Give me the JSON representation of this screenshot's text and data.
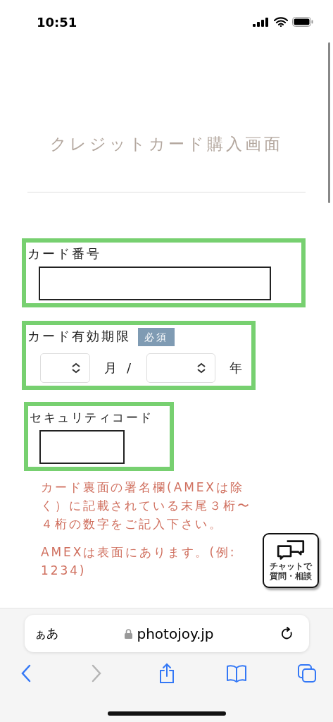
{
  "status_bar": {
    "time": "10:51"
  },
  "title": "クレジットカード購入画面",
  "card_number": {
    "label": "カード番号"
  },
  "expiry": {
    "label": "カード有効期限",
    "required_badge": "必須",
    "month_unit": "月",
    "separator": "/",
    "year_unit": "年"
  },
  "security_code": {
    "label": "セキュリティコード",
    "notes": [
      "カード裏面の署名欄(AMEXは除く）に記載されている末尾３桁〜４桁の数字をご記入下さい。",
      "AMEXは表面にあります。(例: 1234)"
    ]
  },
  "chat_button": {
    "lines": [
      "チャットで",
      "質問・相談"
    ]
  },
  "browser": {
    "text_size_button": "ぁあ",
    "url": "photojoy.jp",
    "forward_disabled": true
  }
}
